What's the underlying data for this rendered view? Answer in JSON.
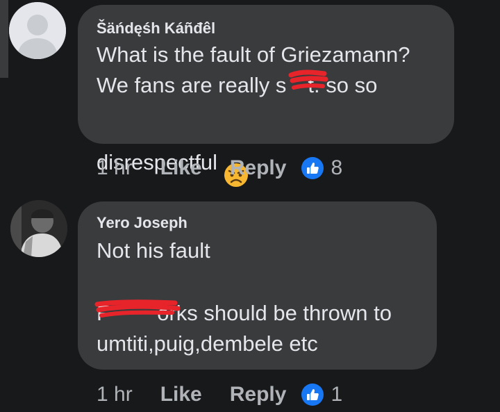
{
  "comments": [
    {
      "author": "Šäńdęśh Káñđêl",
      "lines": [
        "What is the fault of Griezamann?",
        "We fans are really s     t. so so",
        "disrespectful"
      ],
      "emoji": "angry-face",
      "time": "1 hr",
      "like_label": "Like",
      "reply_label": "Reply",
      "reaction_count": "8"
    },
    {
      "author": "Yero Joseph",
      "lines": [
        "Not his fault",
        "",
        "F           orks should be thrown to",
        "umtiti,puig,dembele etc"
      ],
      "time": "1 hr",
      "like_label": "Like",
      "reply_label": "Reply",
      "reaction_count": "1"
    }
  ],
  "colors": {
    "background": "#18191a",
    "bubble": "#3a3b3c",
    "text": "#e4e6eb",
    "muted": "#b0b3b8",
    "accent": "#1877f2",
    "redaction": "#e8242b"
  }
}
